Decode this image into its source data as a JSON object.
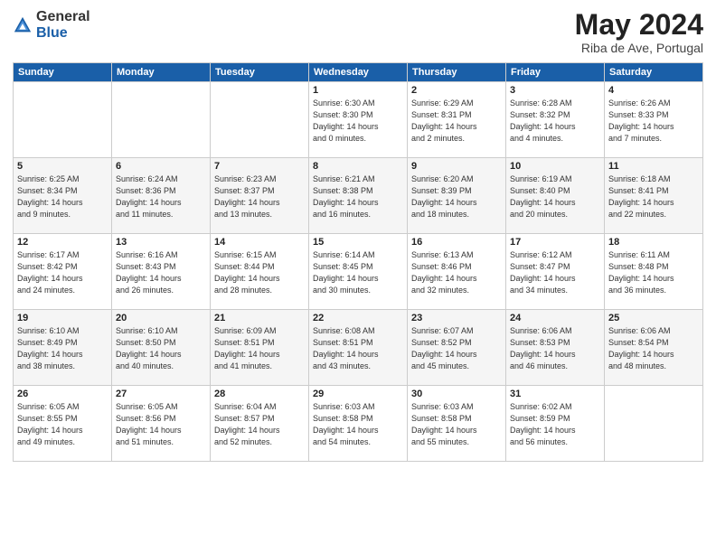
{
  "header": {
    "logo_general": "General",
    "logo_blue": "Blue",
    "month_title": "May 2024",
    "subtitle": "Riba de Ave, Portugal"
  },
  "weekdays": [
    "Sunday",
    "Monday",
    "Tuesday",
    "Wednesday",
    "Thursday",
    "Friday",
    "Saturday"
  ],
  "weeks": [
    [
      {
        "day": "",
        "lines": []
      },
      {
        "day": "",
        "lines": []
      },
      {
        "day": "",
        "lines": []
      },
      {
        "day": "1",
        "lines": [
          "Sunrise: 6:30 AM",
          "Sunset: 8:30 PM",
          "Daylight: 14 hours",
          "and 0 minutes."
        ]
      },
      {
        "day": "2",
        "lines": [
          "Sunrise: 6:29 AM",
          "Sunset: 8:31 PM",
          "Daylight: 14 hours",
          "and 2 minutes."
        ]
      },
      {
        "day": "3",
        "lines": [
          "Sunrise: 6:28 AM",
          "Sunset: 8:32 PM",
          "Daylight: 14 hours",
          "and 4 minutes."
        ]
      },
      {
        "day": "4",
        "lines": [
          "Sunrise: 6:26 AM",
          "Sunset: 8:33 PM",
          "Daylight: 14 hours",
          "and 7 minutes."
        ]
      }
    ],
    [
      {
        "day": "5",
        "lines": [
          "Sunrise: 6:25 AM",
          "Sunset: 8:34 PM",
          "Daylight: 14 hours",
          "and 9 minutes."
        ]
      },
      {
        "day": "6",
        "lines": [
          "Sunrise: 6:24 AM",
          "Sunset: 8:36 PM",
          "Daylight: 14 hours",
          "and 11 minutes."
        ]
      },
      {
        "day": "7",
        "lines": [
          "Sunrise: 6:23 AM",
          "Sunset: 8:37 PM",
          "Daylight: 14 hours",
          "and 13 minutes."
        ]
      },
      {
        "day": "8",
        "lines": [
          "Sunrise: 6:21 AM",
          "Sunset: 8:38 PM",
          "Daylight: 14 hours",
          "and 16 minutes."
        ]
      },
      {
        "day": "9",
        "lines": [
          "Sunrise: 6:20 AM",
          "Sunset: 8:39 PM",
          "Daylight: 14 hours",
          "and 18 minutes."
        ]
      },
      {
        "day": "10",
        "lines": [
          "Sunrise: 6:19 AM",
          "Sunset: 8:40 PM",
          "Daylight: 14 hours",
          "and 20 minutes."
        ]
      },
      {
        "day": "11",
        "lines": [
          "Sunrise: 6:18 AM",
          "Sunset: 8:41 PM",
          "Daylight: 14 hours",
          "and 22 minutes."
        ]
      }
    ],
    [
      {
        "day": "12",
        "lines": [
          "Sunrise: 6:17 AM",
          "Sunset: 8:42 PM",
          "Daylight: 14 hours",
          "and 24 minutes."
        ]
      },
      {
        "day": "13",
        "lines": [
          "Sunrise: 6:16 AM",
          "Sunset: 8:43 PM",
          "Daylight: 14 hours",
          "and 26 minutes."
        ]
      },
      {
        "day": "14",
        "lines": [
          "Sunrise: 6:15 AM",
          "Sunset: 8:44 PM",
          "Daylight: 14 hours",
          "and 28 minutes."
        ]
      },
      {
        "day": "15",
        "lines": [
          "Sunrise: 6:14 AM",
          "Sunset: 8:45 PM",
          "Daylight: 14 hours",
          "and 30 minutes."
        ]
      },
      {
        "day": "16",
        "lines": [
          "Sunrise: 6:13 AM",
          "Sunset: 8:46 PM",
          "Daylight: 14 hours",
          "and 32 minutes."
        ]
      },
      {
        "day": "17",
        "lines": [
          "Sunrise: 6:12 AM",
          "Sunset: 8:47 PM",
          "Daylight: 14 hours",
          "and 34 minutes."
        ]
      },
      {
        "day": "18",
        "lines": [
          "Sunrise: 6:11 AM",
          "Sunset: 8:48 PM",
          "Daylight: 14 hours",
          "and 36 minutes."
        ]
      }
    ],
    [
      {
        "day": "19",
        "lines": [
          "Sunrise: 6:10 AM",
          "Sunset: 8:49 PM",
          "Daylight: 14 hours",
          "and 38 minutes."
        ]
      },
      {
        "day": "20",
        "lines": [
          "Sunrise: 6:10 AM",
          "Sunset: 8:50 PM",
          "Daylight: 14 hours",
          "and 40 minutes."
        ]
      },
      {
        "day": "21",
        "lines": [
          "Sunrise: 6:09 AM",
          "Sunset: 8:51 PM",
          "Daylight: 14 hours",
          "and 41 minutes."
        ]
      },
      {
        "day": "22",
        "lines": [
          "Sunrise: 6:08 AM",
          "Sunset: 8:51 PM",
          "Daylight: 14 hours",
          "and 43 minutes."
        ]
      },
      {
        "day": "23",
        "lines": [
          "Sunrise: 6:07 AM",
          "Sunset: 8:52 PM",
          "Daylight: 14 hours",
          "and 45 minutes."
        ]
      },
      {
        "day": "24",
        "lines": [
          "Sunrise: 6:06 AM",
          "Sunset: 8:53 PM",
          "Daylight: 14 hours",
          "and 46 minutes."
        ]
      },
      {
        "day": "25",
        "lines": [
          "Sunrise: 6:06 AM",
          "Sunset: 8:54 PM",
          "Daylight: 14 hours",
          "and 48 minutes."
        ]
      }
    ],
    [
      {
        "day": "26",
        "lines": [
          "Sunrise: 6:05 AM",
          "Sunset: 8:55 PM",
          "Daylight: 14 hours",
          "and 49 minutes."
        ]
      },
      {
        "day": "27",
        "lines": [
          "Sunrise: 6:05 AM",
          "Sunset: 8:56 PM",
          "Daylight: 14 hours",
          "and 51 minutes."
        ]
      },
      {
        "day": "28",
        "lines": [
          "Sunrise: 6:04 AM",
          "Sunset: 8:57 PM",
          "Daylight: 14 hours",
          "and 52 minutes."
        ]
      },
      {
        "day": "29",
        "lines": [
          "Sunrise: 6:03 AM",
          "Sunset: 8:58 PM",
          "Daylight: 14 hours",
          "and 54 minutes."
        ]
      },
      {
        "day": "30",
        "lines": [
          "Sunrise: 6:03 AM",
          "Sunset: 8:58 PM",
          "Daylight: 14 hours",
          "and 55 minutes."
        ]
      },
      {
        "day": "31",
        "lines": [
          "Sunrise: 6:02 AM",
          "Sunset: 8:59 PM",
          "Daylight: 14 hours",
          "and 56 minutes."
        ]
      },
      {
        "day": "",
        "lines": []
      }
    ]
  ]
}
